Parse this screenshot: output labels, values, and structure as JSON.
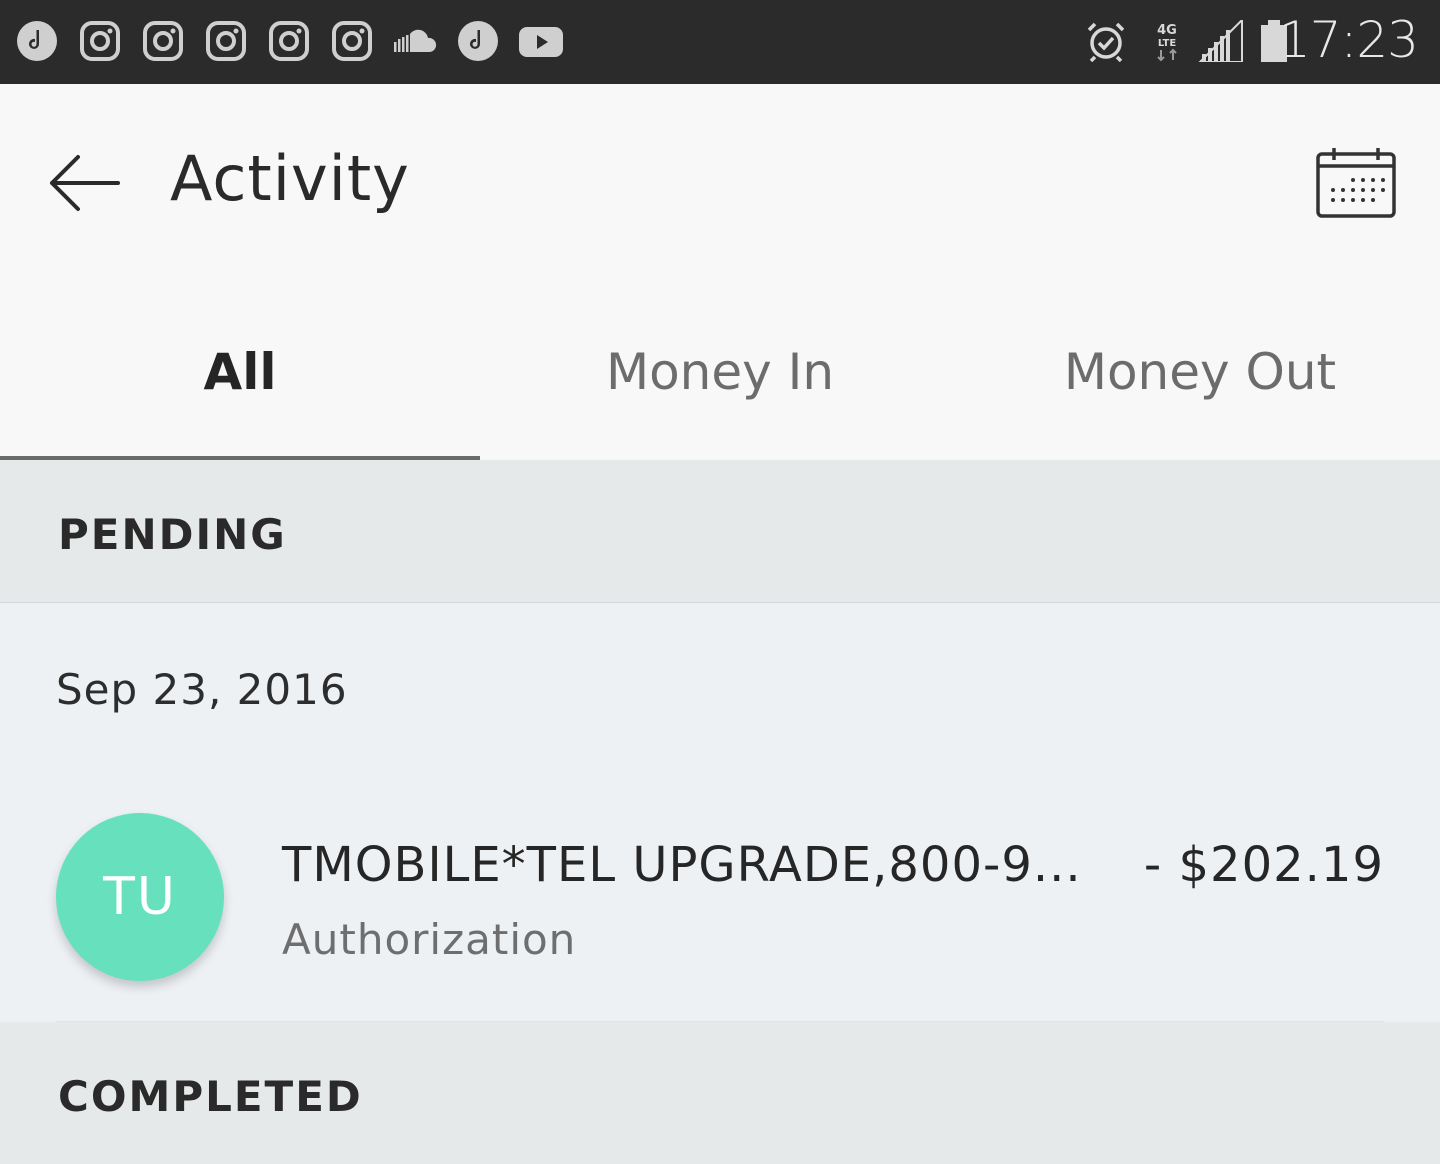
{
  "status_bar": {
    "clock": "17:23",
    "left_icons": [
      "tiktok-icon",
      "instagram-icon",
      "instagram-icon",
      "instagram-icon",
      "instagram-icon",
      "instagram-icon",
      "soundcloud-icon",
      "tiktok-icon",
      "youtube-icon"
    ],
    "right_icons": [
      "alarm-icon",
      "4g-lte-icon",
      "signal-icon",
      "battery-icon"
    ],
    "network_label": "4G LTE"
  },
  "header": {
    "title": "Activity"
  },
  "tabs": [
    {
      "label": "All",
      "active": true
    },
    {
      "label": "Money In",
      "active": false
    },
    {
      "label": "Money Out",
      "active": false
    }
  ],
  "sections": {
    "pending": {
      "title": "PENDING",
      "groups": [
        {
          "date": "Sep 23, 2016",
          "transactions": [
            {
              "avatar_initials": "TU",
              "avatar_color": "#66e0bd",
              "merchant": "TMOBILE*TEL UPGRADE,800-9...",
              "type": "Authorization",
              "amount": "- $202.19"
            }
          ]
        }
      ]
    },
    "completed": {
      "title": "COMPLETED"
    }
  },
  "colors": {
    "status_bar_bg": "#2b2b2b",
    "header_bg": "#f8f8f8",
    "section_bg": "#e6e9ea",
    "list_bg": "#edf1f4",
    "avatar": "#66e0bd"
  }
}
